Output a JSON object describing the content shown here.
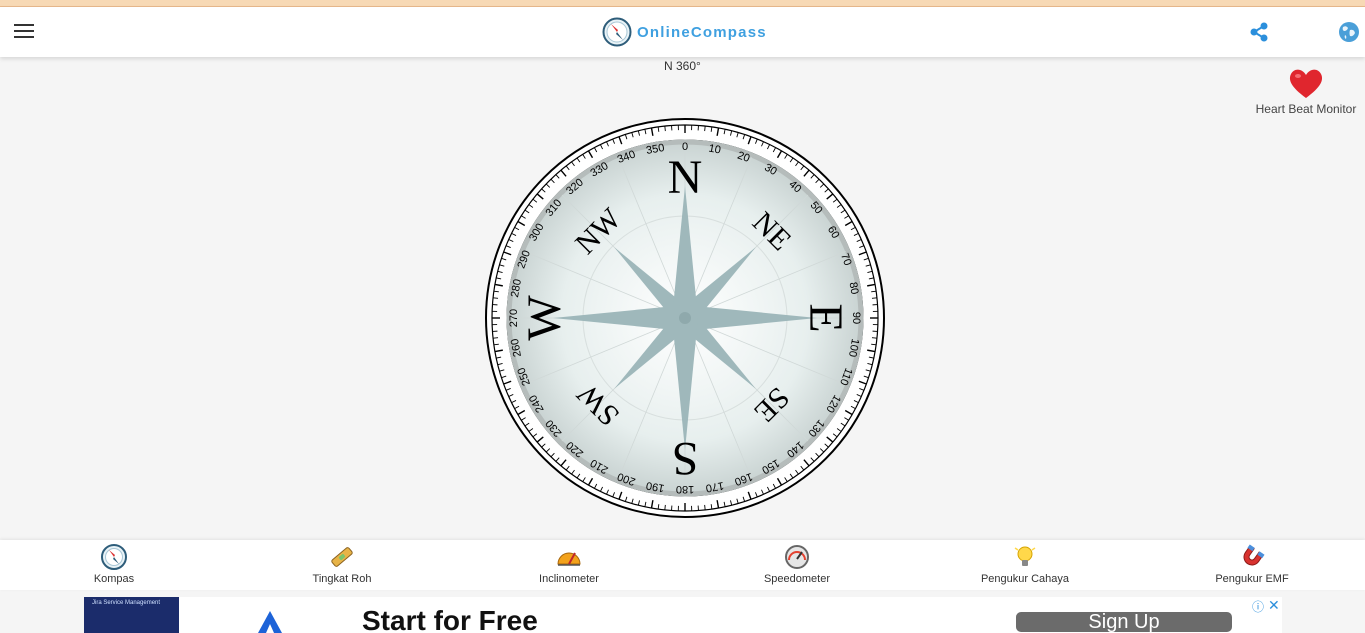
{
  "header": {
    "brand_name": "OnlineCompass",
    "menu_icon": "hamburger-menu-icon",
    "share_icon": "share-icon",
    "language_icon": "globe-icon"
  },
  "compass": {
    "heading_text": "N 360°",
    "heading_degrees": 360,
    "cardinals": [
      "N",
      "NE",
      "E",
      "SE",
      "S",
      "SW",
      "W",
      "NW"
    ],
    "degree_labels": [
      "0",
      "10",
      "20",
      "30",
      "40",
      "50",
      "60",
      "70",
      "80",
      "90",
      "100",
      "110",
      "120",
      "130",
      "140",
      "150",
      "160",
      "170",
      "180",
      "190",
      "200",
      "210",
      "220",
      "230",
      "240",
      "250",
      "260",
      "270",
      "280",
      "290",
      "300",
      "310",
      "320",
      "330",
      "340",
      "350"
    ],
    "rose_color": "#9fb8bb",
    "dial_color": "#e7efee"
  },
  "heart_link": {
    "label": "Heart Beat Monitor",
    "icon": "heart-icon",
    "color": "#e0262e"
  },
  "bottom_nav": [
    {
      "label": "Kompas",
      "icon": "compass-icon"
    },
    {
      "label": "Tingkat Roh",
      "icon": "spirit-level-icon"
    },
    {
      "label": "Inclinometer",
      "icon": "inclinometer-icon"
    },
    {
      "label": "Speedometer",
      "icon": "speedometer-icon"
    },
    {
      "label": "Pengukur Cahaya",
      "icon": "light-bulb-icon"
    },
    {
      "label": "Pengukur EMF",
      "icon": "magnet-icon"
    }
  ],
  "ad": {
    "thumb_text": "Jira Service Management",
    "headline": "Start for Free",
    "cta": "Sign Up",
    "info_icon": "ad-info-icon",
    "close_icon": "ad-close-icon"
  },
  "colors": {
    "brand": "#3fa0e0",
    "accent_strip": "#f7d9b5"
  }
}
